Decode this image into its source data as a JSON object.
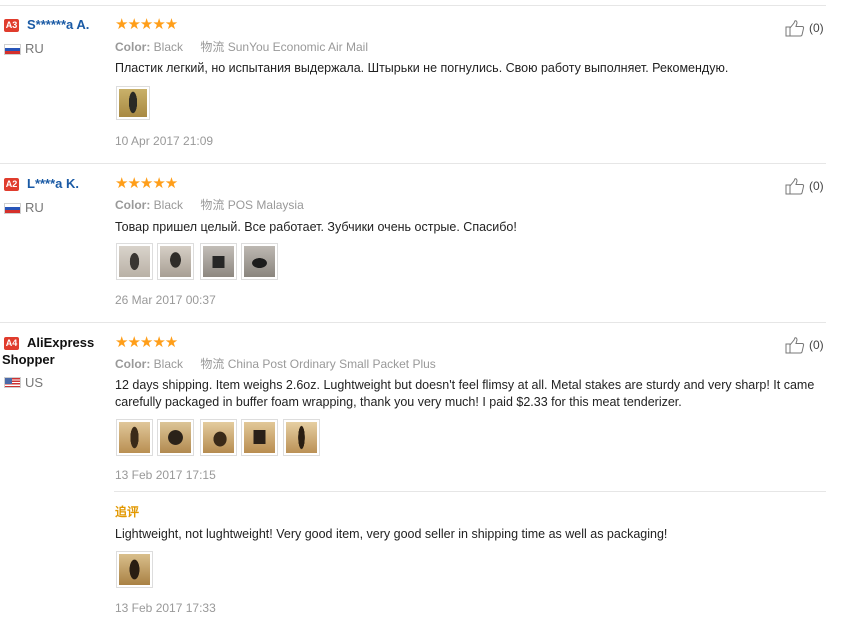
{
  "reviews": [
    {
      "level": "A3",
      "user": "S******a A.",
      "country": "RU",
      "stars": "★★★★★",
      "color_label": "Color:",
      "color_value": "Black",
      "shipping_label": "物流",
      "shipping_value": "SunYou Economic Air Mail",
      "text": "Пластик легкий, но испытания выдержала. Штырьки не погнулись. Свою работу выполняет. Рекомендую.",
      "date": "10 Apr 2017 21:09",
      "helpful": "(0)",
      "photo_count": 1
    },
    {
      "level": "A2",
      "user": "L****a K.",
      "country": "RU",
      "stars": "★★★★★",
      "color_label": "Color:",
      "color_value": "Black",
      "shipping_label": "物流",
      "shipping_value": "POS Malaysia",
      "text": "Товар пришел целый. Все работает. Зубчики очень острые. Спасибо!",
      "date": "26 Mar 2017 00:37",
      "helpful": "(0)",
      "photo_count": 4
    },
    {
      "level": "A4",
      "user": "AliExpress Shopper",
      "country": "US",
      "stars": "★★★★★",
      "color_label": "Color:",
      "color_value": "Black",
      "shipping_label": "物流",
      "shipping_value": "China Post Ordinary Small Packet Plus",
      "text": "12 days shipping. Item weighs 2.6oz. Lughtweight but doesn't feel flimsy at all. Metal stakes are sturdy and very sharp! It came carefully packaged in buffer foam wrapping, thank you very much! I paid $2.33 for this meat tenderizer.",
      "date": "13 Feb 2017 17:15",
      "helpful": "(0)",
      "photo_count": 5,
      "followup": {
        "label": "追评",
        "text": "Lightweight, not lughtweight! Very good item, very good seller in shipping time as well as packaging!",
        "date": "13 Feb 2017 17:33",
        "photo_count": 1
      }
    }
  ],
  "colors": {
    "star": "#ff9e19",
    "username": "#1a5aa5",
    "badge": "#e03c2d",
    "followup_label": "#e29800"
  },
  "icons": {
    "helpful": "thumbs-up-icon"
  }
}
